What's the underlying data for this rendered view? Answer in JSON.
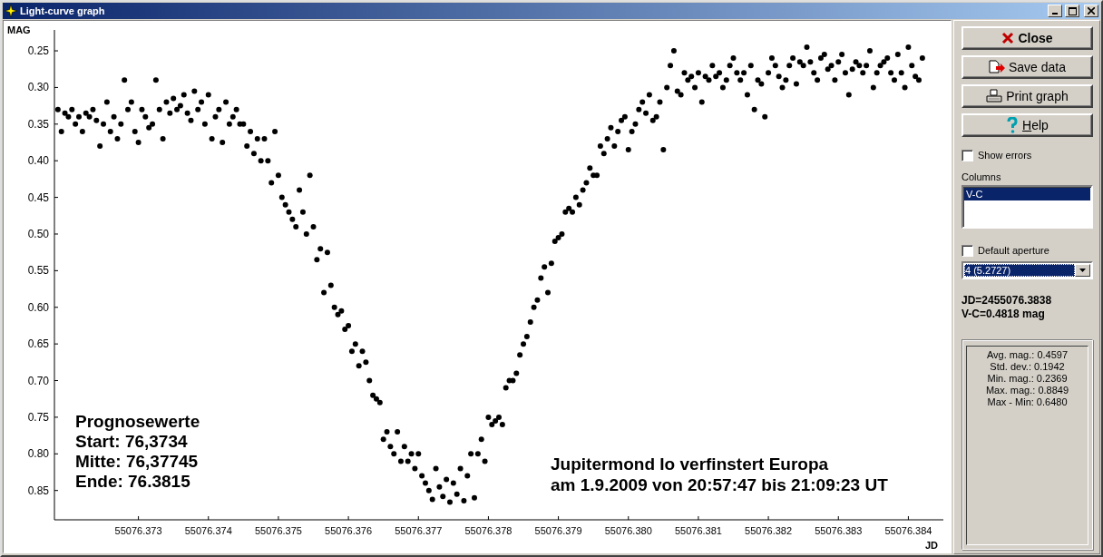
{
  "window": {
    "title": "Light-curve graph"
  },
  "chart": {
    "chart_data": {
      "type": "scatter",
      "xlabel": "JD",
      "ylabel": "MAG",
      "xlim": [
        55076.3718,
        55076.3845
      ],
      "ylim": [
        0.89,
        0.219
      ],
      "xticks": [
        {
          "value": 55076.373,
          "label": "55076.373"
        },
        {
          "value": 55076.374,
          "label": "55076.374"
        },
        {
          "value": 55076.375,
          "label": "55076.375"
        },
        {
          "value": 55076.376,
          "label": "55076.376"
        },
        {
          "value": 55076.377,
          "label": "55076.377"
        },
        {
          "value": 55076.378,
          "label": "55076.378"
        },
        {
          "value": 55076.379,
          "label": "55076.379"
        },
        {
          "value": 55076.38,
          "label": "55076.380"
        },
        {
          "value": 55076.381,
          "label": "55076.381"
        },
        {
          "value": 55076.382,
          "label": "55076.382"
        },
        {
          "value": 55076.383,
          "label": "55076.383"
        },
        {
          "value": 55076.384,
          "label": "55076.384"
        }
      ],
      "yticks": [
        {
          "value": 0.25,
          "label": "0.25"
        },
        {
          "value": 0.3,
          "label": "0.30"
        },
        {
          "value": 0.35,
          "label": "0.35"
        },
        {
          "value": 0.4,
          "label": "0.40"
        },
        {
          "value": 0.45,
          "label": "0.45"
        },
        {
          "value": 0.5,
          "label": "0.50"
        },
        {
          "value": 0.55,
          "label": "0.55"
        },
        {
          "value": 0.6,
          "label": "0.60"
        },
        {
          "value": 0.65,
          "label": "0.65"
        },
        {
          "value": 0.7,
          "label": "0.70"
        },
        {
          "value": 0.75,
          "label": "0.75"
        },
        {
          "value": 0.8,
          "label": "0.80"
        },
        {
          "value": 0.85,
          "label": "0.85"
        }
      ],
      "x": [
        55076.37185,
        55076.3719,
        55076.37195,
        55076.372,
        55076.37205,
        55076.3721,
        55076.37215,
        55076.3722,
        55076.37225,
        55076.3723,
        55076.37235,
        55076.3724,
        55076.37245,
        55076.3725,
        55076.37255,
        55076.3726,
        55076.37265,
        55076.3727,
        55076.37275,
        55076.3728,
        55076.37285,
        55076.3729,
        55076.37295,
        55076.373,
        55076.37305,
        55076.3731,
        55076.37315,
        55076.3732,
        55076.37325,
        55076.3733,
        55076.37335,
        55076.3734,
        55076.37345,
        55076.3735,
        55076.37355,
        55076.3736,
        55076.37365,
        55076.3737,
        55076.37375,
        55076.3738,
        55076.37385,
        55076.3739,
        55076.37395,
        55076.374,
        55076.37405,
        55076.3741,
        55076.37415,
        55076.3742,
        55076.37425,
        55076.3743,
        55076.37435,
        55076.3744,
        55076.37445,
        55076.3745,
        55076.37455,
        55076.3746,
        55076.37465,
        55076.3747,
        55076.37475,
        55076.3748,
        55076.37485,
        55076.3749,
        55076.37495,
        55076.375,
        55076.37505,
        55076.3751,
        55076.37515,
        55076.3752,
        55076.37525,
        55076.3753,
        55076.37535,
        55076.3754,
        55076.37545,
        55076.3755,
        55076.37555,
        55076.3756,
        55076.37565,
        55076.3757,
        55076.37575,
        55076.3758,
        55076.37585,
        55076.3759,
        55076.37595,
        55076.376,
        55076.37605,
        55076.3761,
        55076.37615,
        55076.3762,
        55076.37625,
        55076.3763,
        55076.37635,
        55076.3764,
        55076.37645,
        55076.3765,
        55076.37655,
        55076.3766,
        55076.37665,
        55076.3767,
        55076.37675,
        55076.3768,
        55076.37685,
        55076.3769,
        55076.37695,
        55076.377,
        55076.37705,
        55076.3771,
        55076.37715,
        55076.3772,
        55076.37725,
        55076.3773,
        55076.37735,
        55076.3774,
        55076.37745,
        55076.3775,
        55076.37755,
        55076.3776,
        55076.37765,
        55076.3777,
        55076.37775,
        55076.3778,
        55076.37785,
        55076.3779,
        55076.37795,
        55076.378,
        55076.37805,
        55076.3781,
        55076.37815,
        55076.3782,
        55076.37825,
        55076.3783,
        55076.37835,
        55076.3784,
        55076.37845,
        55076.3785,
        55076.37855,
        55076.3786,
        55076.37865,
        55076.3787,
        55076.37875,
        55076.3788,
        55076.37885,
        55076.3789,
        55076.37895,
        55076.379,
        55076.37905,
        55076.3791,
        55076.37915,
        55076.3792,
        55076.37925,
        55076.3793,
        55076.37935,
        55076.3794,
        55076.37945,
        55076.3795,
        55076.37955,
        55076.3796,
        55076.37965,
        55076.3797,
        55076.37975,
        55076.3798,
        55076.37985,
        55076.3799,
        55076.37995,
        55076.38,
        55076.38005,
        55076.3801,
        55076.38015,
        55076.3802,
        55076.38025,
        55076.3803,
        55076.38035,
        55076.3804,
        55076.38045,
        55076.3805,
        55076.38055,
        55076.3806,
        55076.38065,
        55076.3807,
        55076.38075,
        55076.3808,
        55076.38085,
        55076.3809,
        55076.38095,
        55076.381,
        55076.38105,
        55076.3811,
        55076.38115,
        55076.3812,
        55076.38125,
        55076.3813,
        55076.38135,
        55076.3814,
        55076.38145,
        55076.3815,
        55076.38155,
        55076.3816,
        55076.38165,
        55076.3817,
        55076.38175,
        55076.3818,
        55076.38185,
        55076.3819,
        55076.38195,
        55076.382,
        55076.38205,
        55076.3821,
        55076.38215,
        55076.3822,
        55076.38225,
        55076.3823,
        55076.38235,
        55076.3824,
        55076.38245,
        55076.3825,
        55076.38255,
        55076.3826,
        55076.38265,
        55076.3827,
        55076.38275,
        55076.3828,
        55076.38285,
        55076.3829,
        55076.38295,
        55076.383,
        55076.38305,
        55076.3831,
        55076.38315,
        55076.3832,
        55076.38325,
        55076.3833,
        55076.38335,
        55076.3834,
        55076.38345,
        55076.3835,
        55076.38355,
        55076.3836,
        55076.38365,
        55076.3837,
        55076.38375,
        55076.3838,
        55076.38385,
        55076.3839,
        55076.38395,
        55076.384,
        55076.38405,
        55076.3841,
        55076.38415,
        55076.3842
      ],
      "series": [
        {
          "color": "#000000",
          "values": [
            0.33,
            0.36,
            0.335,
            0.34,
            0.33,
            0.35,
            0.34,
            0.36,
            0.335,
            0.34,
            0.33,
            0.345,
            0.38,
            0.35,
            0.32,
            0.36,
            0.34,
            0.37,
            0.35,
            0.29,
            0.33,
            0.32,
            0.36,
            0.375,
            0.33,
            0.34,
            0.355,
            0.35,
            0.29,
            0.33,
            0.37,
            0.32,
            0.335,
            0.315,
            0.33,
            0.325,
            0.31,
            0.335,
            0.345,
            0.305,
            0.33,
            0.32,
            0.35,
            0.31,
            0.37,
            0.34,
            0.33,
            0.375,
            0.32,
            0.35,
            0.34,
            0.33,
            0.35,
            0.35,
            0.38,
            0.36,
            0.39,
            0.37,
            0.4,
            0.37,
            0.4,
            0.43,
            0.36,
            0.42,
            0.45,
            0.46,
            0.47,
            0.48,
            0.49,
            0.44,
            0.47,
            0.5,
            0.42,
            0.49,
            0.535,
            0.52,
            0.58,
            0.525,
            0.57,
            0.6,
            0.61,
            0.605,
            0.63,
            0.625,
            0.66,
            0.65,
            0.68,
            0.66,
            0.675,
            0.7,
            0.72,
            0.725,
            0.73,
            0.78,
            0.77,
            0.79,
            0.8,
            0.77,
            0.81,
            0.79,
            0.81,
            0.8,
            0.82,
            0.8,
            0.83,
            0.84,
            0.85,
            0.862,
            0.82,
            0.845,
            0.858,
            0.835,
            0.866,
            0.84,
            0.855,
            0.82,
            0.864,
            0.83,
            0.8,
            0.86,
            0.8,
            0.78,
            0.81,
            0.75,
            0.76,
            0.755,
            0.75,
            0.76,
            0.71,
            0.7,
            0.7,
            0.69,
            0.665,
            0.65,
            0.64,
            0.62,
            0.6,
            0.59,
            0.56,
            0.545,
            0.58,
            0.54,
            0.51,
            0.505,
            0.5,
            0.47,
            0.465,
            0.47,
            0.45,
            0.46,
            0.44,
            0.43,
            0.41,
            0.42,
            0.42,
            0.38,
            0.39,
            0.37,
            0.355,
            0.38,
            0.36,
            0.345,
            0.34,
            0.385,
            0.36,
            0.35,
            0.33,
            0.32,
            0.335,
            0.31,
            0.345,
            0.34,
            0.32,
            0.385,
            0.3,
            0.27,
            0.25,
            0.305,
            0.31,
            0.28,
            0.29,
            0.285,
            0.3,
            0.28,
            0.32,
            0.285,
            0.29,
            0.27,
            0.285,
            0.28,
            0.3,
            0.29,
            0.27,
            0.26,
            0.28,
            0.29,
            0.28,
            0.31,
            0.27,
            0.33,
            0.29,
            0.295,
            0.34,
            0.28,
            0.26,
            0.27,
            0.285,
            0.3,
            0.29,
            0.27,
            0.26,
            0.295,
            0.265,
            0.27,
            0.245,
            0.265,
            0.28,
            0.29,
            0.26,
            0.255,
            0.275,
            0.27,
            0.29,
            0.265,
            0.255,
            0.28,
            0.31,
            0.275,
            0.265,
            0.27,
            0.28,
            0.27,
            0.25,
            0.3,
            0.28,
            0.27,
            0.265,
            0.26,
            0.28,
            0.29,
            0.255,
            0.28,
            0.3,
            0.245,
            0.27,
            0.285,
            0.29,
            0.26
          ]
        }
      ],
      "annotations": [
        {
          "text": "Prognosewerte"
        },
        {
          "text": "Start: 76,3734"
        },
        {
          "text": "Mitte: 76,37745"
        },
        {
          "text": "Ende: 76.3815"
        },
        {
          "text": "Jupitermond Io verfinstert Europa"
        },
        {
          "text": "am 1.9.2009 von 20:57:47 bis 21:09:23 UT"
        }
      ]
    }
  },
  "sidebar": {
    "buttons": [
      {
        "label": "Close",
        "kind": "close"
      },
      {
        "label": "Save data",
        "kind": "save"
      },
      {
        "label": "Print graph",
        "kind": "print"
      },
      {
        "label": "Help",
        "kind": "help"
      }
    ],
    "show_errors": {
      "label": "Show errors",
      "checked": false
    },
    "columns": {
      "label": "Columns",
      "items": [
        {
          "label": "V-C",
          "selected": true
        }
      ]
    },
    "default_aperture": {
      "label": "Default aperture",
      "checked": false
    },
    "aperture_select": {
      "value": "4 (5.2727)"
    },
    "readout": [
      "JD=2455076.3838",
      "V-C=0.4818 mag"
    ],
    "stats": [
      "Avg. mag.: 0.4597",
      "Std. dev.: 0.1942",
      "Min. mag.: 0.2369",
      "Max. mag.: 0.8849",
      "Max - Min: 0.6480"
    ]
  }
}
